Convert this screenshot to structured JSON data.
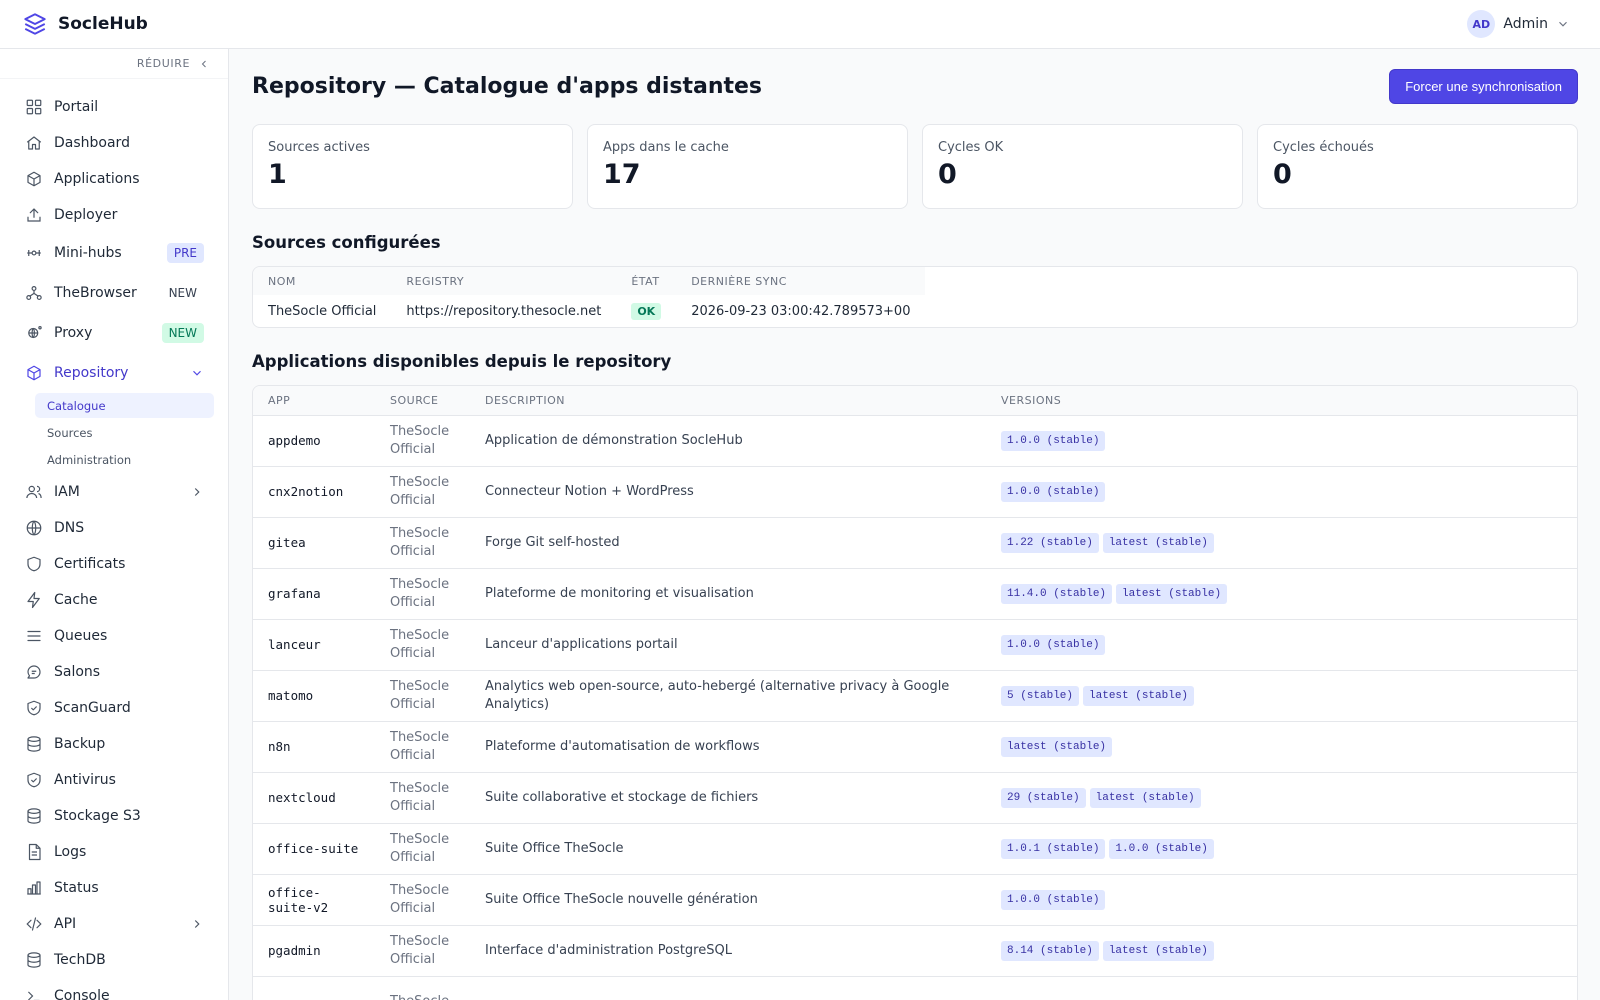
{
  "app": {
    "name": "SocleHub"
  },
  "user": {
    "initials": "AD",
    "name": "Admin"
  },
  "sidebar": {
    "collapse_label": "RÉDUIRE",
    "items": [
      {
        "label": "Portail"
      },
      {
        "label": "Dashboard"
      },
      {
        "label": "Applications"
      },
      {
        "label": "Deployer"
      },
      {
        "label": "Mini-hubs",
        "badge": "PRE"
      },
      {
        "label": "TheBrowser",
        "badge": "NEW"
      },
      {
        "label": "Proxy",
        "badge": "NEW"
      },
      {
        "label": "Repository"
      },
      {
        "label": "IAM"
      },
      {
        "label": "DNS"
      },
      {
        "label": "Certificats"
      },
      {
        "label": "Cache"
      },
      {
        "label": "Queues"
      },
      {
        "label": "Salons"
      },
      {
        "label": "ScanGuard"
      },
      {
        "label": "Backup"
      },
      {
        "label": "Antivirus"
      },
      {
        "label": "Stockage S3"
      },
      {
        "label": "Logs"
      },
      {
        "label": "Status"
      },
      {
        "label": "API"
      },
      {
        "label": "TechDB"
      },
      {
        "label": "Console"
      }
    ],
    "repository_sub": [
      {
        "label": "Catalogue"
      },
      {
        "label": "Sources"
      },
      {
        "label": "Administration"
      }
    ]
  },
  "page": {
    "title": "Repository — Catalogue d'apps distantes",
    "sync_button": "Forcer une synchronisation"
  },
  "stats": [
    {
      "label": "Sources actives",
      "value": "1"
    },
    {
      "label": "Apps dans le cache",
      "value": "17"
    },
    {
      "label": "Cycles OK",
      "value": "0"
    },
    {
      "label": "Cycles échoués",
      "value": "0"
    }
  ],
  "sources": {
    "title": "Sources configurées",
    "columns": [
      "NOM",
      "REGISTRY",
      "ÉTAT",
      "DERNIÈRE SYNC"
    ],
    "rows": [
      {
        "name": "TheSocle Official",
        "registry": "https://repository.thesocle.net",
        "state": "OK",
        "last_sync": "2026-09-23 03:00:42.789573+00"
      }
    ]
  },
  "apps": {
    "title": "Applications disponibles depuis le repository",
    "columns": [
      "APP",
      "SOURCE",
      "DESCRIPTION",
      "VERSIONS"
    ],
    "rows": [
      {
        "app": "appdemo",
        "source_l1": "TheSocle",
        "source_l2": "Official",
        "description": "Application de démonstration SocleHub",
        "versions": [
          "1.0.0 (stable)"
        ]
      },
      {
        "app": "cnx2notion",
        "source_l1": "TheSocle",
        "source_l2": "Official",
        "description": "Connecteur Notion + WordPress",
        "versions": [
          "1.0.0 (stable)"
        ]
      },
      {
        "app": "gitea",
        "source_l1": "TheSocle",
        "source_l2": "Official",
        "description": "Forge Git self-hosted",
        "versions": [
          "1.22 (stable)",
          "latest (stable)"
        ]
      },
      {
        "app": "grafana",
        "source_l1": "TheSocle",
        "source_l2": "Official",
        "description": "Plateforme de monitoring et visualisation",
        "versions": [
          "11.4.0 (stable)",
          "latest (stable)"
        ]
      },
      {
        "app": "lanceur",
        "source_l1": "TheSocle",
        "source_l2": "Official",
        "description": "Lanceur d'applications portail",
        "versions": [
          "1.0.0 (stable)"
        ]
      },
      {
        "app": "matomo",
        "source_l1": "TheSocle",
        "source_l2": "Official",
        "description": "Analytics web open-source, auto-hebergé (alternative privacy à Google Analytics)",
        "versions": [
          "5 (stable)",
          "latest (stable)"
        ]
      },
      {
        "app": "n8n",
        "source_l1": "TheSocle",
        "source_l2": "Official",
        "description": "Plateforme d'automatisation de workflows",
        "versions": [
          "latest (stable)"
        ]
      },
      {
        "app": "nextcloud",
        "source_l1": "TheSocle",
        "source_l2": "Official",
        "description": "Suite collaborative et stockage de fichiers",
        "versions": [
          "29 (stable)",
          "latest (stable)"
        ]
      },
      {
        "app": "office-suite",
        "source_l1": "TheSocle",
        "source_l2": "Official",
        "description": "Suite Office TheSocle",
        "versions": [
          "1.0.1 (stable)",
          "1.0.0 (stable)"
        ]
      },
      {
        "app": "office-suite-v2",
        "source_l1": "TheSocle",
        "source_l2": "Official",
        "description": "Suite Office TheSocle nouvelle génération",
        "versions": [
          "1.0.0 (stable)"
        ]
      },
      {
        "app": "pgadmin",
        "source_l1": "TheSocle",
        "source_l2": "Official",
        "description": "Interface d'administration PostgreSQL",
        "versions": [
          "8.14 (stable)",
          "latest (stable)"
        ]
      },
      {
        "app": "",
        "source_l1": "TheSocle",
        "source_l2": "",
        "description": "",
        "versions": []
      }
    ]
  }
}
